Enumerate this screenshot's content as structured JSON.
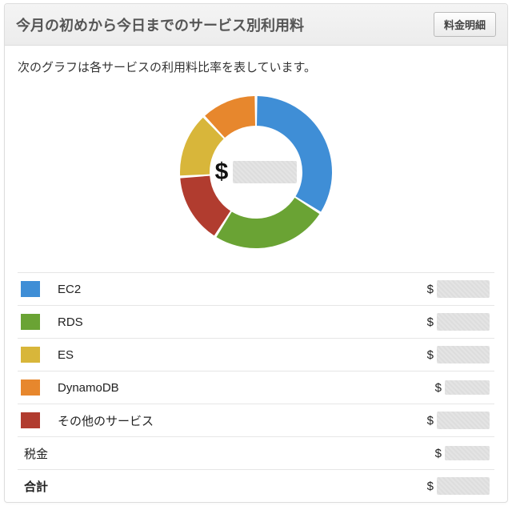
{
  "header": {
    "title": "今月の初めから今日までのサービス別利用料",
    "detail_button": "料金明細"
  },
  "subtitle": "次のグラフは各サービスの利用料比率を表しています。",
  "center": {
    "currency_symbol": "$",
    "value_redacted": true
  },
  "legend_items": [
    {
      "label": "EC2",
      "color": "#3f8ed6",
      "currency_symbol": "$",
      "value_redacted": true
    },
    {
      "label": "RDS",
      "color": "#6aa334",
      "currency_symbol": "$",
      "value_redacted": true
    },
    {
      "label": "ES",
      "color": "#d8b63a",
      "currency_symbol": "$",
      "value_redacted": true
    },
    {
      "label": "DynamoDB",
      "color": "#e7872d",
      "currency_symbol": "$",
      "value_redacted": true
    },
    {
      "label": "その他のサービス",
      "color": "#b13c2f",
      "currency_symbol": "$",
      "value_redacted": true
    }
  ],
  "tax": {
    "label": "税金",
    "currency_symbol": "$",
    "value_redacted": true
  },
  "total": {
    "label": "合計",
    "currency_symbol": "$",
    "value_redacted": true
  },
  "chart_data": {
    "type": "pie",
    "title": "今月の初めから今日までのサービス別利用料",
    "note": "Donut chart of month-to-date spend share by AWS service. Exact dollar values are redacted in the source image; shares below are estimated from arc angles.",
    "series": [
      {
        "name": "EC2",
        "share": 0.34,
        "color": "#3f8ed6"
      },
      {
        "name": "RDS",
        "share": 0.25,
        "color": "#6aa334"
      },
      {
        "name": "その他のサービス",
        "share": 0.15,
        "color": "#b13c2f"
      },
      {
        "name": "ES",
        "share": 0.14,
        "color": "#d8b63a"
      },
      {
        "name": "DynamoDB",
        "share": 0.12,
        "color": "#e7872d"
      }
    ],
    "center_value_redacted": true,
    "currency": "$"
  }
}
